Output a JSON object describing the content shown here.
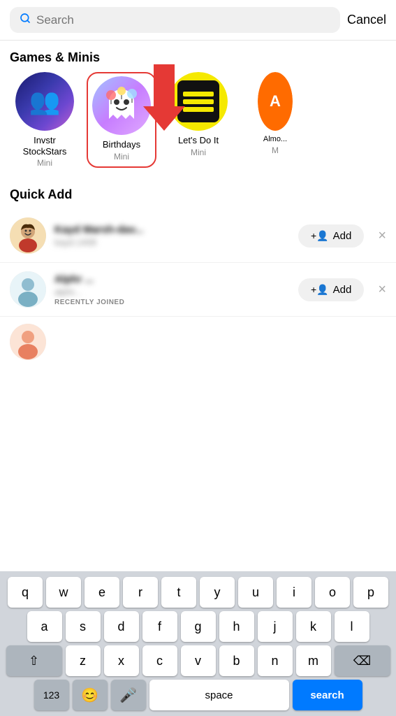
{
  "header": {
    "search_placeholder": "Search",
    "cancel_label": "Cancel"
  },
  "games_section": {
    "title": "Games & Minis",
    "items": [
      {
        "id": "invstr",
        "name": "Invstr\nStockStars",
        "type": "Mini",
        "highlighted": false
      },
      {
        "id": "birthdays",
        "name": "Birthdays",
        "type": "Mini",
        "highlighted": true
      },
      {
        "id": "letsdo",
        "name": "Let's Do It",
        "type": "Mini",
        "highlighted": false
      },
      {
        "id": "almo",
        "name": "Almo...",
        "type": "M",
        "highlighted": false
      }
    ]
  },
  "quick_add_section": {
    "title": "Quick Add",
    "items": [
      {
        "id": "user1",
        "name": "Kayd Marsh-dav...",
        "sub": "kayd.1408",
        "badge": "",
        "add_label": "Add",
        "avatar_type": "person1"
      },
      {
        "id": "user2",
        "name": "Alphr ...",
        "sub": "alphr...",
        "badge": "RECENTLY JOINED",
        "add_label": "Add",
        "avatar_type": "person2"
      }
    ]
  },
  "keyboard": {
    "rows": [
      [
        "q",
        "w",
        "e",
        "r",
        "t",
        "y",
        "u",
        "i",
        "o",
        "p"
      ],
      [
        "a",
        "s",
        "d",
        "f",
        "g",
        "h",
        "j",
        "k",
        "l"
      ],
      [
        "⇧",
        "z",
        "x",
        "c",
        "v",
        "b",
        "n",
        "m",
        "⌫"
      ]
    ],
    "bottom": [
      "123",
      "😊",
      "🎤",
      "space",
      "search"
    ]
  }
}
